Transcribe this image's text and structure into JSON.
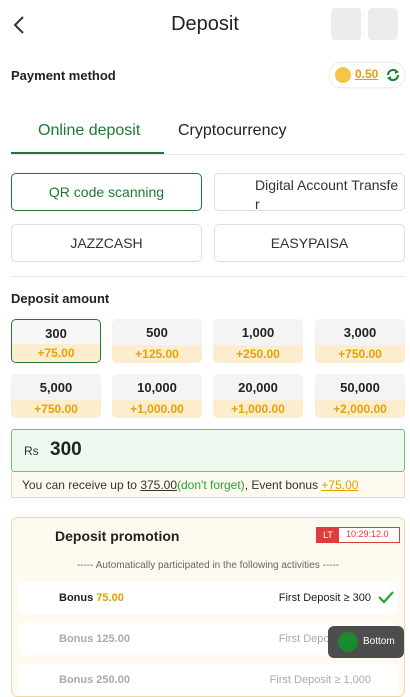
{
  "header": {
    "title": "Deposit"
  },
  "payment": {
    "label": "Payment method",
    "balance": "0.50"
  },
  "tabs": [
    {
      "label": "Online deposit"
    },
    {
      "label": "Cryptocurrency"
    }
  ],
  "methods": [
    {
      "label": "QR code scanning"
    },
    {
      "label": "Digital Account Transfer"
    },
    {
      "label": "JAZZCASH"
    },
    {
      "label": "EASYPAISA"
    }
  ],
  "amounts": {
    "label": "Deposit amount",
    "options": [
      {
        "value": "300",
        "bonus": "+75.00"
      },
      {
        "value": "500",
        "bonus": "+125.00"
      },
      {
        "value": "1,000",
        "bonus": "+250.00"
      },
      {
        "value": "3,000",
        "bonus": "+750.00"
      },
      {
        "value": "5,000",
        "bonus": "+750.00"
      },
      {
        "value": "10,000",
        "bonus": "+1,000.00"
      },
      {
        "value": "20,000",
        "bonus": "+1,000.00"
      },
      {
        "value": "50,000",
        "bonus": "+2,000.00"
      }
    ]
  },
  "input": {
    "currency": "Rs",
    "value": "300"
  },
  "info": {
    "prefix": "You can receive up to ",
    "amount": "375.00",
    "note": "(don't forget)",
    "mid": ", Event bonus ",
    "bonus": "+75.00"
  },
  "promo": {
    "title": "Deposit promotion",
    "badge": "LT",
    "timer": "10:29:12.0",
    "auto_text": "----- Automatically participated in the following activities -----",
    "rows": [
      {
        "bonus_label": "Bonus",
        "bonus_value": "75.00",
        "condition": "First Deposit ≥ 300"
      },
      {
        "bonus_label": "Bonus",
        "bonus_value": "125.00",
        "condition": "First Deposit ≥ 500"
      },
      {
        "bonus_label": "Bonus",
        "bonus_value": "250.00",
        "condition": "First Deposit ≥ 1,000"
      }
    ]
  },
  "bottom_button": {
    "label": "Bottom"
  },
  "colors": {
    "accent": "#1f7a2f",
    "bonus": "#e8a200",
    "timer": "#e23b3b"
  }
}
